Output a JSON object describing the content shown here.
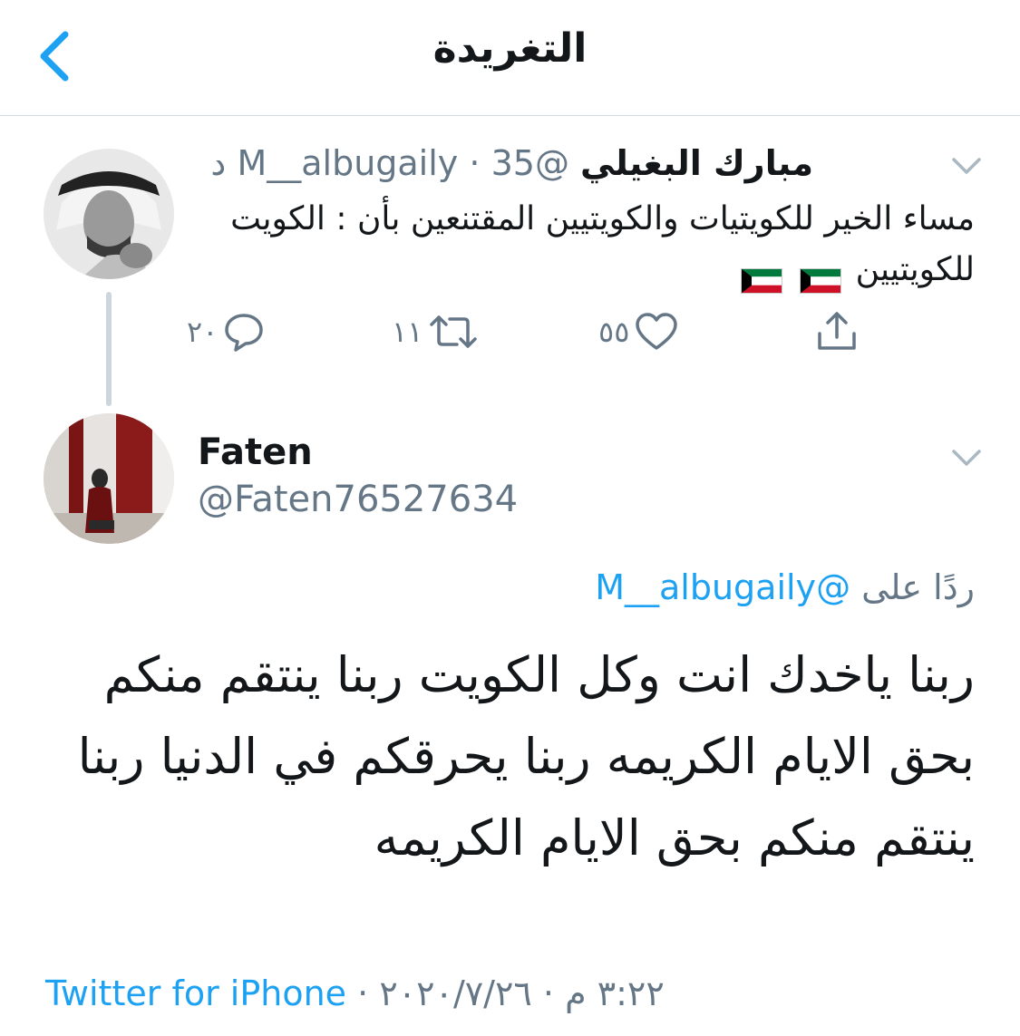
{
  "nav": {
    "title": "التغريدة"
  },
  "parent_tweet": {
    "name": "مبارك البغيلي",
    "handle": "@M__albugaily",
    "separator": "·",
    "time": "35 د",
    "text": "مساء الخير للكويتيات والكويتيين المقتنعين بأن : الكويت للكويتيين",
    "flags": [
      "kuwait-flag",
      "kuwait-flag"
    ],
    "actions": {
      "reply_count": "٢٠",
      "retweet_count": "١١",
      "like_count": "٥٥"
    }
  },
  "reply_tweet": {
    "name": "Faten",
    "handle": "@Faten76527634",
    "replying_to_label": "ردًا على",
    "replying_to_handle": "@M__albugaily",
    "text": "ربنا ياخدك انت وكل الكويت ربنا ينتقم منكم بحق الايام الكريمه ربنا يحرقكم في الدنيا ربنا ينتقم منكم بحق الايام الكريمه",
    "time": "٣:٢٢ م",
    "date": "٢٠٢٠/٧/٢٦",
    "separator": "·",
    "source": "Twitter for iPhone"
  },
  "colors": {
    "accent": "#1da1f2",
    "secondary_text": "#657786",
    "primary_text": "#14171a",
    "divider": "#d4d9de",
    "thread_line": "#ccd6dd"
  }
}
